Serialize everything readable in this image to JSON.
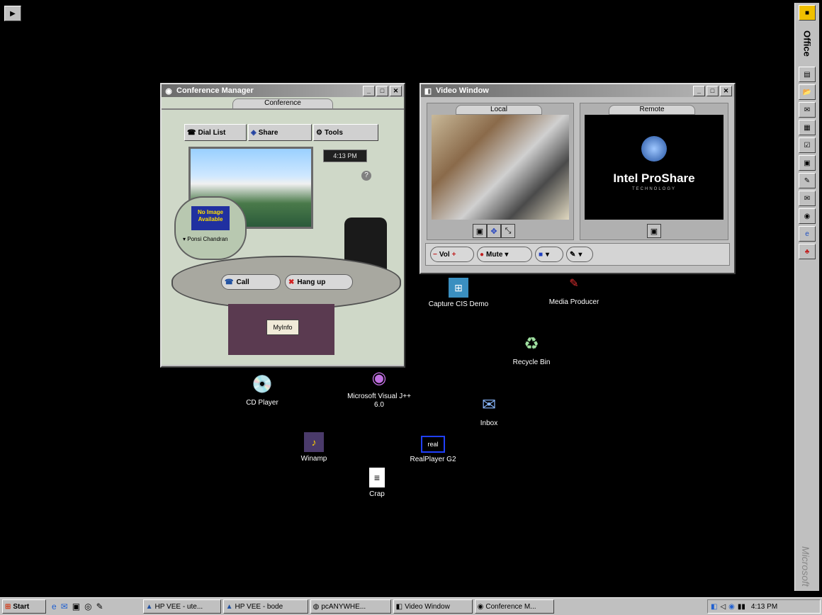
{
  "desktop": {
    "icons": [
      {
        "label": "Capture CIS Demo"
      },
      {
        "label": "Media Producer"
      },
      {
        "label": "Recycle Bin"
      },
      {
        "label": "CD Player"
      },
      {
        "label": "Microsoft Visual J++ 6.0"
      },
      {
        "label": "Inbox"
      },
      {
        "label": "Winamp"
      },
      {
        "label": "RealPlayer G2"
      },
      {
        "label": "Crap"
      }
    ]
  },
  "conference_manager": {
    "title": "Conference Manager",
    "tab": "Conference",
    "dial_list": "Dial List",
    "share": "Share",
    "tools": "Tools",
    "clock": "4:13 PM",
    "help": "?",
    "no_image": "No Image Available",
    "contact": "Ponsi Chandran",
    "call": "Call",
    "hang_up": "Hang up",
    "my_info": "MyInfo"
  },
  "video_window": {
    "title": "Video Window",
    "local_tab": "Local",
    "remote_tab": "Remote",
    "brand_main": "Intel ProShare",
    "brand_sub": "TECHNOLOGY",
    "vol": "Vol",
    "mute": "Mute"
  },
  "officebar": {
    "label": "Office",
    "vendor": "Microsoft"
  },
  "taskbar": {
    "start": "Start",
    "tasks": [
      {
        "label": "HP VEE - ute..."
      },
      {
        "label": "HP VEE - bode"
      },
      {
        "label": "pcANYWHE..."
      },
      {
        "label": "Video Window"
      },
      {
        "label": "Conference M..."
      }
    ],
    "clock": "4:13 PM"
  },
  "colors": {
    "desktop": "#000000",
    "chrome": "#c0c0c0",
    "title_gradient": "#6a6a6a"
  }
}
